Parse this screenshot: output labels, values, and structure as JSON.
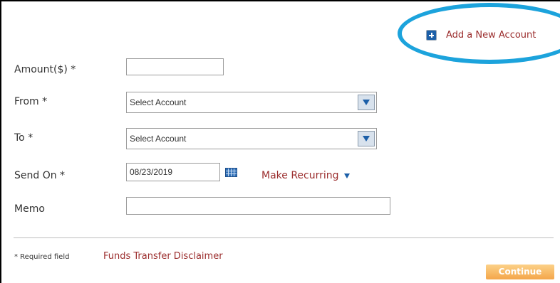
{
  "header": {
    "add_account_label": "Add a New Account"
  },
  "form": {
    "amount": {
      "label": "Amount($) *",
      "value": ""
    },
    "from": {
      "label": "From *",
      "selected": "Select Account"
    },
    "to": {
      "label": "To *",
      "selected": "Select Account"
    },
    "send_on": {
      "label": "Send On *",
      "value": "08/23/2019"
    },
    "make_recurring_label": "Make Recurring",
    "memo": {
      "label": "Memo",
      "value": ""
    }
  },
  "footer": {
    "required_note": "* Required field",
    "disclaimer_link": "Funds Transfer Disclaimer",
    "continue_label": "Continue"
  },
  "icons": [
    "plus-icon",
    "dropdown-arrow-icon",
    "calendar-icon",
    "caret-down-icon"
  ],
  "colors": {
    "link": "#9b2d2d",
    "accent_blue": "#1c5fa8",
    "annotation": "#1ca3dc",
    "continue_button": "#f4a64a"
  }
}
